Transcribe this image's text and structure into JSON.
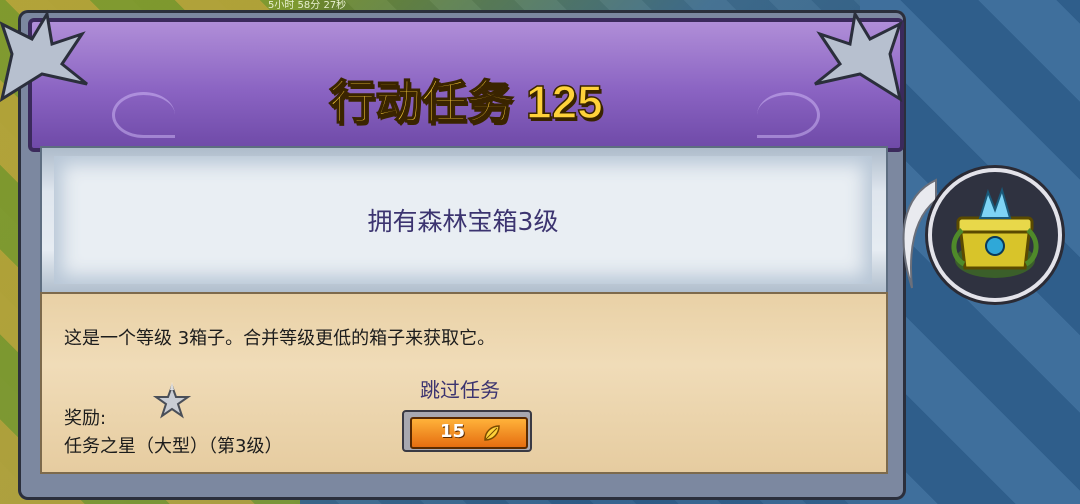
{
  "hud": {
    "timer_text": "5小时 58分 27秒"
  },
  "header": {
    "title": "行动任务 125"
  },
  "objective": {
    "text": "拥有森林宝箱3级"
  },
  "description": {
    "text": "这是一个等级 3箱子。合并等级更低的箱子来获取它。"
  },
  "reward": {
    "label": "奖励:",
    "name": "任务之星（大型）（第3级）"
  },
  "skip": {
    "label": "跳过任务",
    "cost": "15"
  },
  "icons": [
    "dragon-statue-icon",
    "star-trophy-icon",
    "gold-leaf-icon",
    "forest-chest-icon"
  ],
  "colors": {
    "title": "#ffd23a",
    "header_purple": "#8a63c2",
    "button_orange": "#e56d10"
  }
}
